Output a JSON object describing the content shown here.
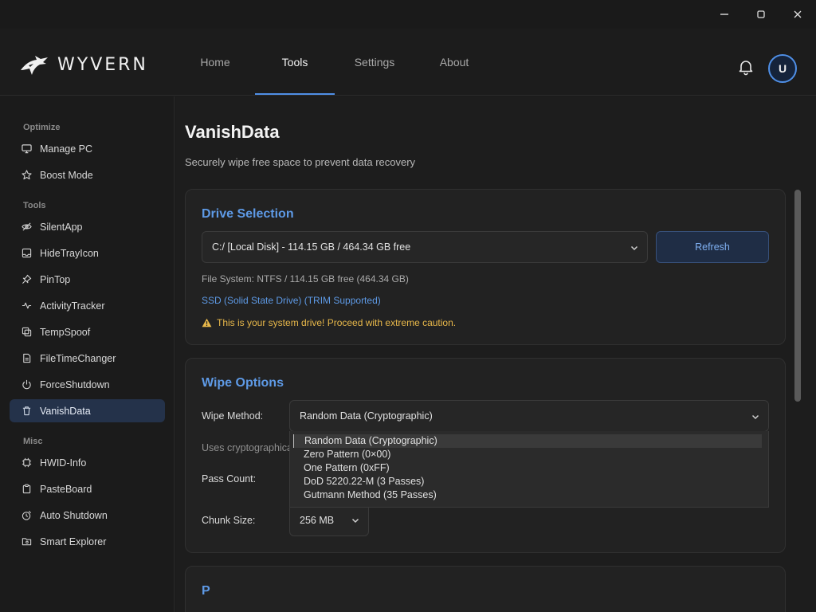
{
  "window": {
    "minimize_icon": "minimize-icon",
    "maximize_icon": "maximize-icon",
    "close_icon": "close-icon"
  },
  "header": {
    "brand": "WYVERN",
    "nav": [
      {
        "label": "Home"
      },
      {
        "label": "Tools",
        "active": true
      },
      {
        "label": "Settings"
      },
      {
        "label": "About"
      }
    ],
    "avatar_initial": "U",
    "accent_color": "#4f8fe6"
  },
  "sidebar": {
    "sections": [
      {
        "label": "Optimize",
        "items": [
          {
            "label": "Manage PC",
            "icon": "monitor-icon"
          },
          {
            "label": "Boost Mode",
            "icon": "star-icon"
          }
        ]
      },
      {
        "label": "Tools",
        "items": [
          {
            "label": "SilentApp",
            "icon": "eye-off-icon"
          },
          {
            "label": "HideTrayIcon",
            "icon": "tray-icon"
          },
          {
            "label": "PinTop",
            "icon": "pin-icon"
          },
          {
            "label": "ActivityTracker",
            "icon": "activity-icon"
          },
          {
            "label": "TempSpoof",
            "icon": "copy-icon"
          },
          {
            "label": "FileTimeChanger",
            "icon": "file-icon"
          },
          {
            "label": "ForceShutdown",
            "icon": "power-icon"
          },
          {
            "label": "VanishData",
            "icon": "trash-icon",
            "active": true
          }
        ]
      },
      {
        "label": "Misc",
        "items": [
          {
            "label": "HWID-Info",
            "icon": "chip-icon"
          },
          {
            "label": "PasteBoard",
            "icon": "clipboard-icon"
          },
          {
            "label": "Auto Shutdown",
            "icon": "timer-power-icon"
          },
          {
            "label": "Smart Explorer",
            "icon": "folder-icon"
          }
        ]
      }
    ]
  },
  "page": {
    "title": "VanishData",
    "subtitle": "Securely wipe free space to prevent data recovery"
  },
  "drive_selection": {
    "title": "Drive Selection",
    "selected_drive": "C:/ [Local Disk] - 114.15 GB / 464.34 GB free",
    "refresh_label": "Refresh",
    "file_system": "File System: NTFS / 114.15 GB free (464.34 GB)",
    "drive_type": "SSD (Solid State Drive) (TRIM Supported)",
    "warning": "This is your system drive! Proceed with extreme caution.",
    "warning_color": "#e8b84a",
    "info_color": "#5e9ae6"
  },
  "wipe_options": {
    "title": "Wipe Options",
    "method_label": "Wipe Method:",
    "method_value": "Random Data (Cryptographic)",
    "method_desc_partial": "Uses cryptographica",
    "method_options": [
      "Random Data (Cryptographic)",
      "Zero Pattern (0×00)",
      "One Pattern (0xFF)",
      "DoD 5220.22-M (3 Passes)",
      "Gutmann Method (35 Passes)"
    ],
    "pass_count_label": "Pass Count:",
    "chunk_size_label": "Chunk Size:",
    "chunk_size_value": "256 MB"
  },
  "next_card": {
    "title_partial": "P"
  }
}
